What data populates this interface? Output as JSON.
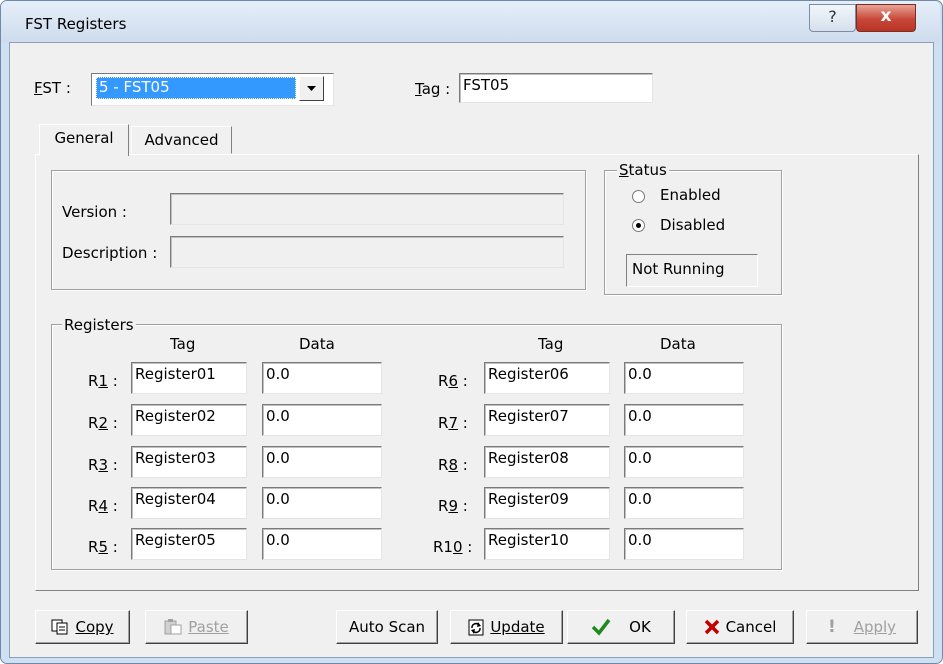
{
  "window": {
    "title": "FST Registers",
    "help_glyph": "?",
    "close_glyph": "x"
  },
  "fst": {
    "label": "FST :",
    "selected": "5 - FST05"
  },
  "tag": {
    "label": "Tag :",
    "value": "FST05"
  },
  "tabs": [
    {
      "label": "General"
    },
    {
      "label": "Advanced"
    }
  ],
  "general": {
    "version_label": "Version :",
    "version_value": "",
    "description_label": "Description :",
    "description_value": ""
  },
  "status": {
    "title": "Status",
    "enabled_label": "Enabled",
    "disabled_label": "Disabled",
    "selected": "Disabled",
    "state_text": "Not Running"
  },
  "registers": {
    "title": "Registers",
    "col_tag": "Tag",
    "col_data": "Data",
    "rows": [
      {
        "label": "R1 :",
        "tag": "Register01",
        "data": "0.0"
      },
      {
        "label": "R2 :",
        "tag": "Register02",
        "data": "0.0"
      },
      {
        "label": "R3 :",
        "tag": "Register03",
        "data": "0.0"
      },
      {
        "label": "R4 :",
        "tag": "Register04",
        "data": "0.0"
      },
      {
        "label": "R5 :",
        "tag": "Register05",
        "data": "0.0"
      },
      {
        "label": "R6 :",
        "tag": "Register06",
        "data": "0.0"
      },
      {
        "label": "R7 :",
        "tag": "Register07",
        "data": "0.0"
      },
      {
        "label": "R8 :",
        "tag": "Register08",
        "data": "0.0"
      },
      {
        "label": "R9 :",
        "tag": "Register09",
        "data": "0.0"
      },
      {
        "label": "R10 :",
        "tag": "Register10",
        "data": "0.0"
      }
    ]
  },
  "buttons": {
    "copy": "Copy",
    "paste": "Paste",
    "auto_scan": "Auto Scan",
    "update": "Update",
    "ok": "OK",
    "cancel": "Cancel",
    "apply": "Apply"
  },
  "icons": {
    "copy": "copy-icon",
    "paste": "paste-icon",
    "update": "update-icon",
    "ok": "checkmark-icon",
    "cancel": "x-icon",
    "apply": "exclamation-icon"
  },
  "colors": {
    "selection": "#3399ff",
    "ok_green": "#1e8a1e",
    "cancel_red": "#c00000"
  }
}
